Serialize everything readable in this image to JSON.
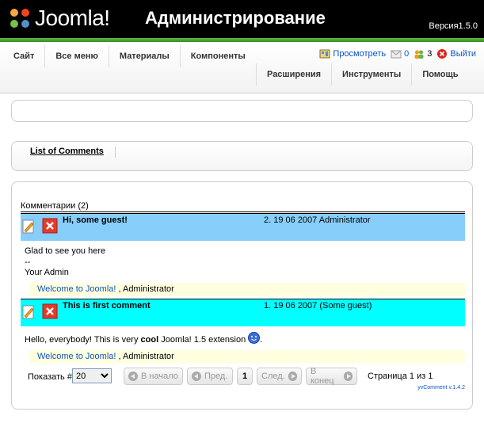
{
  "header": {
    "logo_text": "Joomla!",
    "title": "Администрирование",
    "version": "Версия1.5.0"
  },
  "menu": {
    "top": [
      "Сайт",
      "Все меню",
      "Материалы",
      "Компоненты"
    ],
    "bottom": [
      "Расширения",
      "Инструменты",
      "Помощь"
    ],
    "preview": "Просмотреть",
    "messages": "0",
    "users": "3",
    "logout": "Выйти"
  },
  "submenu": {
    "label": "List of Comments"
  },
  "comments": {
    "heading": "Комментарии (2)",
    "items": [
      {
        "title": "Hi, some guest!",
        "meta": "2. 19 06 2007 Administrator",
        "body": "Glad to see you here\n--\nYour Admin",
        "foot_link": "Welcome to Joomla!",
        "foot_author": ", Administrator",
        "bg": "#87cefa"
      },
      {
        "title": "This is first comment",
        "meta": "1. 19 06 2007 (Some guest)",
        "body_pre": "Hello, everybody! This is very ",
        "body_bold": "cool",
        "body_post": " Joomla! 1.5 extension ",
        "body_end": ".",
        "foot_link": "Welcome to Joomla!",
        "foot_author": ", Administrator",
        "bg": "#00ffff"
      }
    ]
  },
  "pager": {
    "label": "Показать #",
    "limit": "20",
    "start": "В начало",
    "prev": "Пред.",
    "current": "1",
    "next": "След.",
    "end": "В конец",
    "info": "Страница 1 из 1",
    "credit": "yvComment v.1.4.2"
  },
  "colors": {
    "header_bg": "#000000",
    "accent_green": "#4aa83a",
    "link": "#0b55c4",
    "foot_bg": "#ffffe0"
  }
}
